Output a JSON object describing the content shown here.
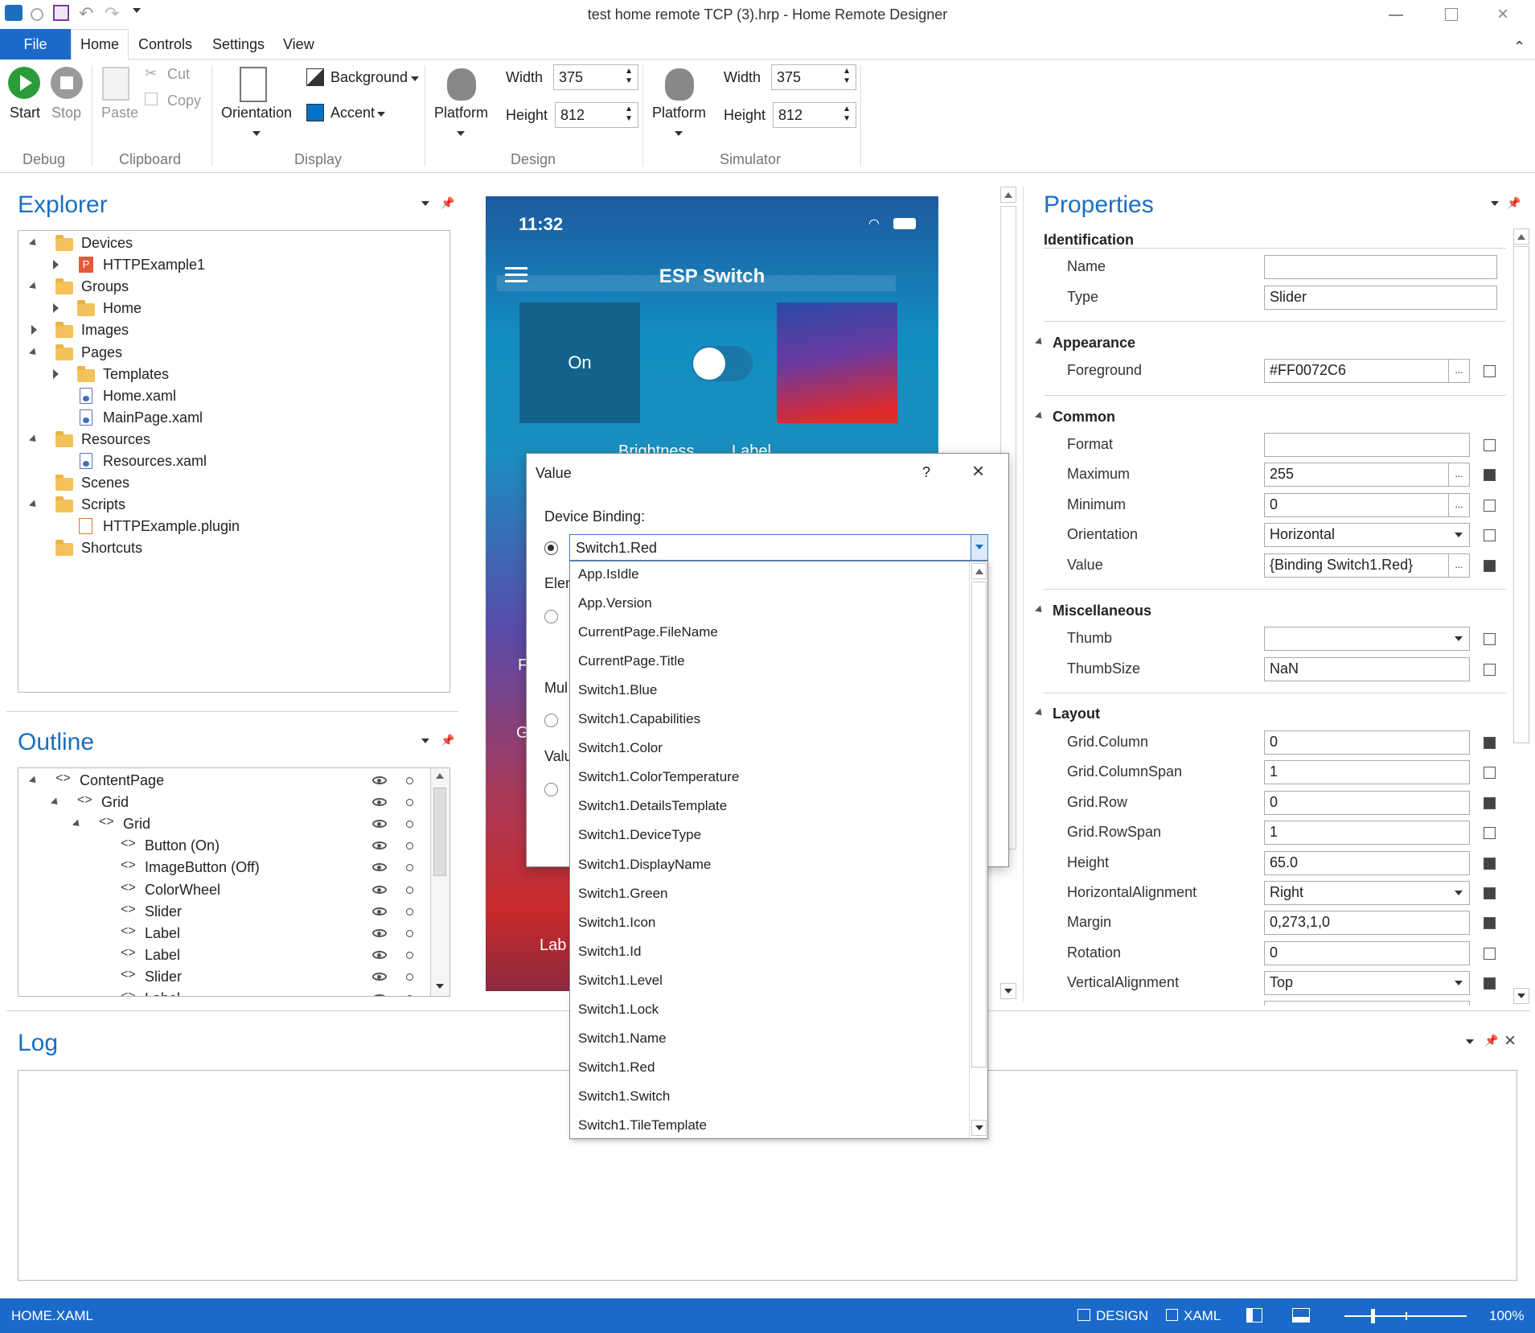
{
  "window": {
    "title": "test home remote TCP (3).hrp - Home Remote Designer"
  },
  "menu": {
    "file": "File",
    "tabs": [
      "Home",
      "Controls",
      "Settings",
      "View"
    ]
  },
  "ribbon": {
    "debug": {
      "group": "Debug",
      "start": "Start",
      "stop": "Stop"
    },
    "clipboard": {
      "group": "Clipboard",
      "paste": "Paste",
      "cut": "Cut",
      "copy": "Copy"
    },
    "display": {
      "group": "Display",
      "orientation": "Orientation",
      "background": "Background",
      "accent": "Accent"
    },
    "design": {
      "group": "Design",
      "platform": "Platform",
      "width_label": "Width",
      "width": "375",
      "height_label": "Height",
      "height": "812"
    },
    "simulator": {
      "group": "Simulator",
      "platform": "Platform",
      "width_label": "Width",
      "width": "375",
      "height_label": "Height",
      "height": "812"
    }
  },
  "explorer": {
    "title": "Explorer",
    "items": [
      "Devices",
      "HTTPExample1",
      "Groups",
      "Home",
      "Images",
      "Pages",
      "Templates",
      "Home.xaml",
      "MainPage.xaml",
      "Resources",
      "Resources.xaml",
      "Scenes",
      "Scripts",
      "HTTPExample.plugin",
      "Shortcuts"
    ]
  },
  "outline": {
    "title": "Outline",
    "items": [
      "ContentPage",
      "Grid",
      "Grid",
      "Button (On)",
      "ImageButton (Off)",
      "ColorWheel",
      "Slider",
      "Label",
      "Label",
      "Slider",
      "Label"
    ]
  },
  "phone": {
    "time": "11:32",
    "title": "ESP Switch",
    "on_button": "On",
    "brightness": "Brightness",
    "label": "Label",
    "edge_f": "F",
    "edge_g": "G",
    "edge_lab": "Lab"
  },
  "dialog": {
    "title": "Value",
    "help": "?",
    "device_binding": "Device Binding:",
    "selected": "Switch1.Red",
    "elem": "Elem",
    "mul": "Mul",
    "valu": "Valu",
    "options": [
      "App.IsIdle",
      "App.Version",
      "CurrentPage.FileName",
      "CurrentPage.Title",
      "Switch1.Blue",
      "Switch1.Capabilities",
      "Switch1.Color",
      "Switch1.ColorTemperature",
      "Switch1.DetailsTemplate",
      "Switch1.DeviceType",
      "Switch1.DisplayName",
      "Switch1.Green",
      "Switch1.Icon",
      "Switch1.Id",
      "Switch1.Level",
      "Switch1.Lock",
      "Switch1.Name",
      "Switch1.Red",
      "Switch1.Switch",
      "Switch1.TileTemplate"
    ]
  },
  "properties": {
    "title": "Properties",
    "identification": {
      "header": "Identification",
      "name_label": "Name",
      "name": "",
      "type_label": "Type",
      "type": "Slider"
    },
    "appearance": {
      "header": "Appearance",
      "foreground_label": "Foreground",
      "foreground": "#FF0072C6"
    },
    "common": {
      "header": "Common",
      "format_label": "Format",
      "format": "",
      "maximum_label": "Maximum",
      "maximum": "255",
      "minimum_label": "Minimum",
      "minimum": "0",
      "orientation_label": "Orientation",
      "orientation": "Horizontal",
      "value_label": "Value",
      "value": "{Binding Switch1.Red}"
    },
    "misc": {
      "header": "Miscellaneous",
      "thumb_label": "Thumb",
      "thumb": "",
      "thumbsize_label": "ThumbSize",
      "thumbsize": "NaN"
    },
    "layout": {
      "header": "Layout",
      "grid_column_label": "Grid.Column",
      "grid_column": "0",
      "grid_columnspan_label": "Grid.ColumnSpan",
      "grid_columnspan": "1",
      "grid_row_label": "Grid.Row",
      "grid_row": "0",
      "grid_rowspan_label": "Grid.RowSpan",
      "grid_rowspan": "1",
      "height_label": "Height",
      "height": "65.0",
      "halign_label": "HorizontalAlignment",
      "halign": "Right",
      "margin_label": "Margin",
      "margin": "0,273,1,0",
      "rotation_label": "Rotation",
      "rotation": "0",
      "valign_label": "VerticalAlignment",
      "valign": "Top"
    }
  },
  "log": {
    "title": "Log"
  },
  "statusbar": {
    "file": "HOME.XAML",
    "design": "DESIGN",
    "xaml": "XAML",
    "zoom": "100%"
  },
  "colors": {
    "accent": "#0072c6",
    "statusbar": "#1b6ac9",
    "background_swatch": "#333333",
    "accent_swatch": "#0072c6"
  }
}
